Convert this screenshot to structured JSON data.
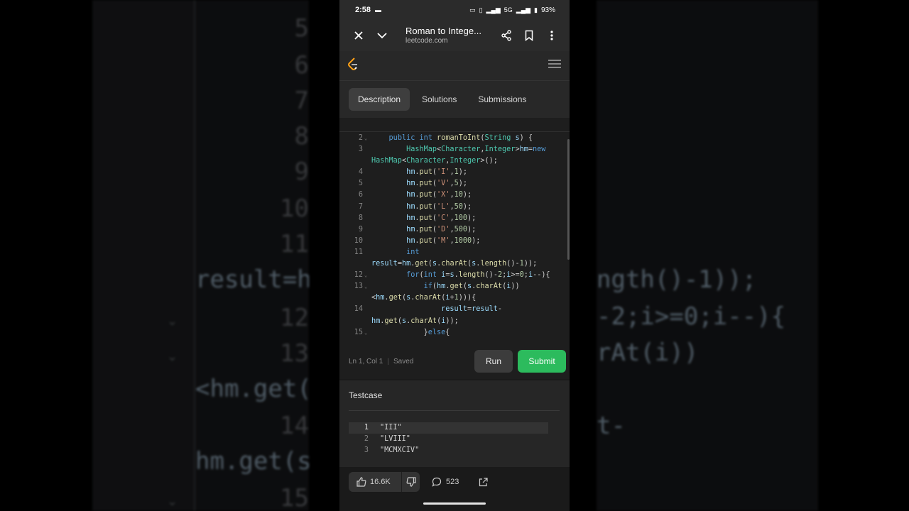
{
  "status": {
    "time": "2:58",
    "battery": "93%",
    "network": "5G"
  },
  "browser": {
    "title": "Roman to Intege...",
    "url": "leetcode.com"
  },
  "tabs": [
    "Description",
    "Solutions",
    "Submissions"
  ],
  "editor": {
    "lines": [
      {
        "n": "2",
        "fold": true
      },
      {
        "n": "3",
        "fold": false
      },
      {
        "n": "",
        "fold": false
      },
      {
        "n": "4",
        "fold": false
      },
      {
        "n": "5",
        "fold": false
      },
      {
        "n": "6",
        "fold": false
      },
      {
        "n": "7",
        "fold": false
      },
      {
        "n": "8",
        "fold": false
      },
      {
        "n": "9",
        "fold": false
      },
      {
        "n": "10",
        "fold": false
      },
      {
        "n": "11",
        "fold": false
      },
      {
        "n": "",
        "fold": false
      },
      {
        "n": "12",
        "fold": true
      },
      {
        "n": "13",
        "fold": true
      },
      {
        "n": "",
        "fold": false
      },
      {
        "n": "14",
        "fold": false
      },
      {
        "n": "",
        "fold": false
      },
      {
        "n": "15",
        "fold": true
      }
    ],
    "code": [
      "    public int romanToInt(String s) {",
      "        HashMap<Character,Integer>hm=new",
      "HashMap<Character,Integer>();",
      "        hm.put('I',1);",
      "        hm.put('V',5);",
      "        hm.put('X',10);",
      "        hm.put('L',50);",
      "        hm.put('C',100);",
      "        hm.put('D',500);",
      "        hm.put('M',1000);",
      "        int",
      "result=hm.get(s.charAt(s.length()-1));",
      "        for(int i=s.length()-2;i>=0;i--){",
      "            if(hm.get(s.charAt(i))",
      "<hm.get(s.charAt(i+1))){",
      "                result=result-",
      "hm.get(s.charAt(i));",
      "            }else{"
    ],
    "status_position": "Ln 1, Col 1",
    "status_saved": "Saved"
  },
  "buttons": {
    "run": "Run",
    "submit": "Submit"
  },
  "testcase": {
    "title": "Testcase",
    "lines": [
      {
        "n": "1",
        "value": "\"III\""
      },
      {
        "n": "2",
        "value": "\"LVIII\""
      },
      {
        "n": "3",
        "value": "\"MCMXCIV\""
      }
    ]
  },
  "footer": {
    "likes": "16.6K",
    "comments": "523"
  },
  "background": {
    "left_numbers": [
      "5",
      "6",
      "7",
      "8",
      "9",
      "10",
      "11",
      "12",
      "13",
      "14",
      "15"
    ],
    "left_code": [
      "result=hm",
      "<hm.get(",
      "hm.get(s"
    ],
    "right_code": [
      "ngth()-1));",
      "-2;i>=0;i--){",
      "rAt(i))",
      "t-"
    ]
  },
  "colors": {
    "submit": "#2cbb5d",
    "keyword": "#569cd6",
    "type": "#4ec9b0",
    "string": "#ce9178"
  }
}
